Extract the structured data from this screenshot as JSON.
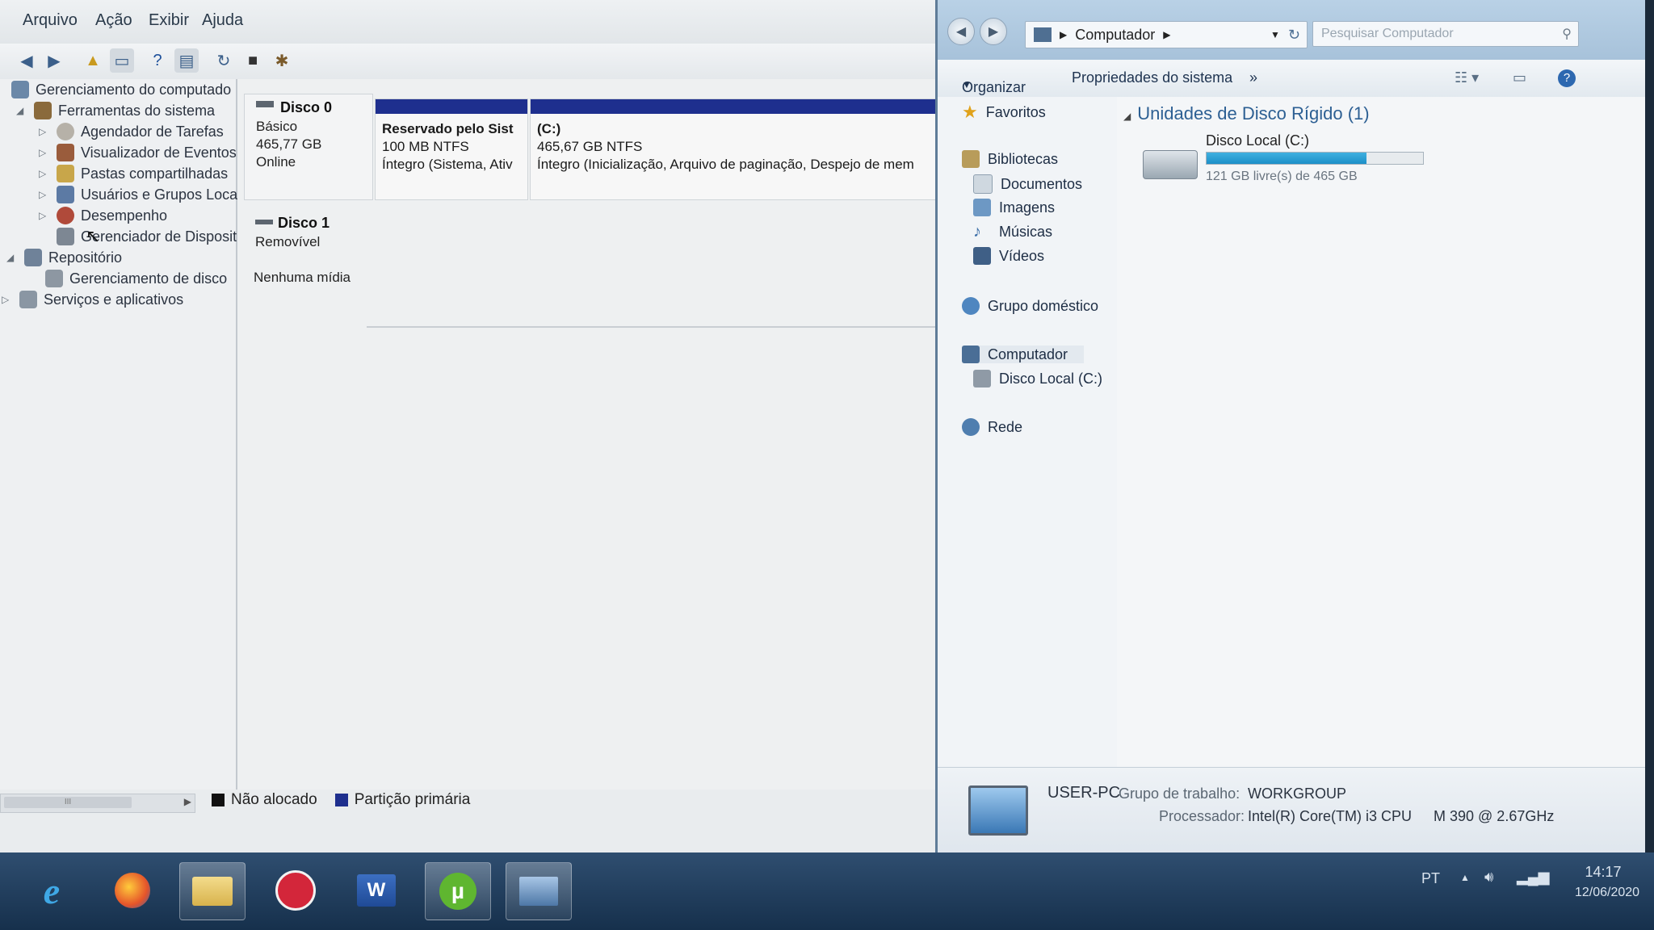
{
  "left_window": {
    "menu": [
      "Arquivo",
      "Ação",
      "Exibir",
      "Ajuda"
    ],
    "tree": {
      "root": "Gerenciamento do computado",
      "system_tools": "Ferramentas do sistema",
      "task_scheduler": "Agendador de Tarefas",
      "event_viewer": "Visualizador de Eventos",
      "shared_folders": "Pastas compartilhadas",
      "users_groups": "Usuários e Grupos Loca",
      "performance": "Desempenho",
      "device_manager": "Gerenciador de Disposit",
      "storage": "Repositório",
      "disk_management": "Gerenciamento de disco",
      "services_apps": "Serviços e aplicativos"
    },
    "scroll_thumb_text": "III",
    "disk0": {
      "name": "Disco 0",
      "type": "Básico",
      "size": "465,77 GB",
      "status": "Online",
      "partitions": [
        {
          "title": "Reservado pelo Sist",
          "size": "100 MB NTFS",
          "status": "Íntegro (Sistema, Ativ"
        },
        {
          "title": "(C:)",
          "size": "465,67 GB NTFS",
          "status": "Íntegro (Inicialização, Arquivo de paginação, Despejo de mem"
        }
      ]
    },
    "disk1": {
      "name": "Disco 1",
      "type": "Removível",
      "media": "Nenhuma mídia"
    },
    "legend": {
      "unallocated": "Não alocado",
      "primary": "Partição primária",
      "unallocated_color": "#111111",
      "primary_color": "#1e2f8e"
    }
  },
  "right_window": {
    "address": "Computador",
    "search_placeholder": "Pesquisar Computador",
    "commands": {
      "organize": "Organizar",
      "system_properties": "Propriedades do sistema",
      "more": "»"
    },
    "nav": {
      "favorites": "Favoritos",
      "libraries": "Bibliotecas",
      "documents": "Documentos",
      "images": "Imagens",
      "music": "Músicas",
      "videos": "Vídeos",
      "homegroup": "Grupo doméstico",
      "computer": "Computador",
      "local_disk": "Disco Local (C:)",
      "network": "Rede"
    },
    "group_header": "Unidades de Disco Rígido (1)",
    "drive": {
      "name": "Disco Local (C:)",
      "free_text": "121 GB livre(s) de 465 GB",
      "used_fraction": 0.74
    },
    "details": {
      "pc_name": "USER-PC",
      "workgroup_label": "Grupo de trabalho:",
      "workgroup": "WORKGROUP",
      "processor_label": "Processador:",
      "processor": "Intel(R) Core(TM) i3 CPU",
      "processor_model": "M 390  @ 2.67GHz"
    }
  },
  "taskbar": {
    "apps": [
      "internet-explorer",
      "firefox",
      "windows-explorer",
      "media-player",
      "word",
      "utorrent",
      "computer-management"
    ],
    "word_letter": "W",
    "lang": "PT",
    "time": "14:17",
    "date": "12/06/2020"
  }
}
